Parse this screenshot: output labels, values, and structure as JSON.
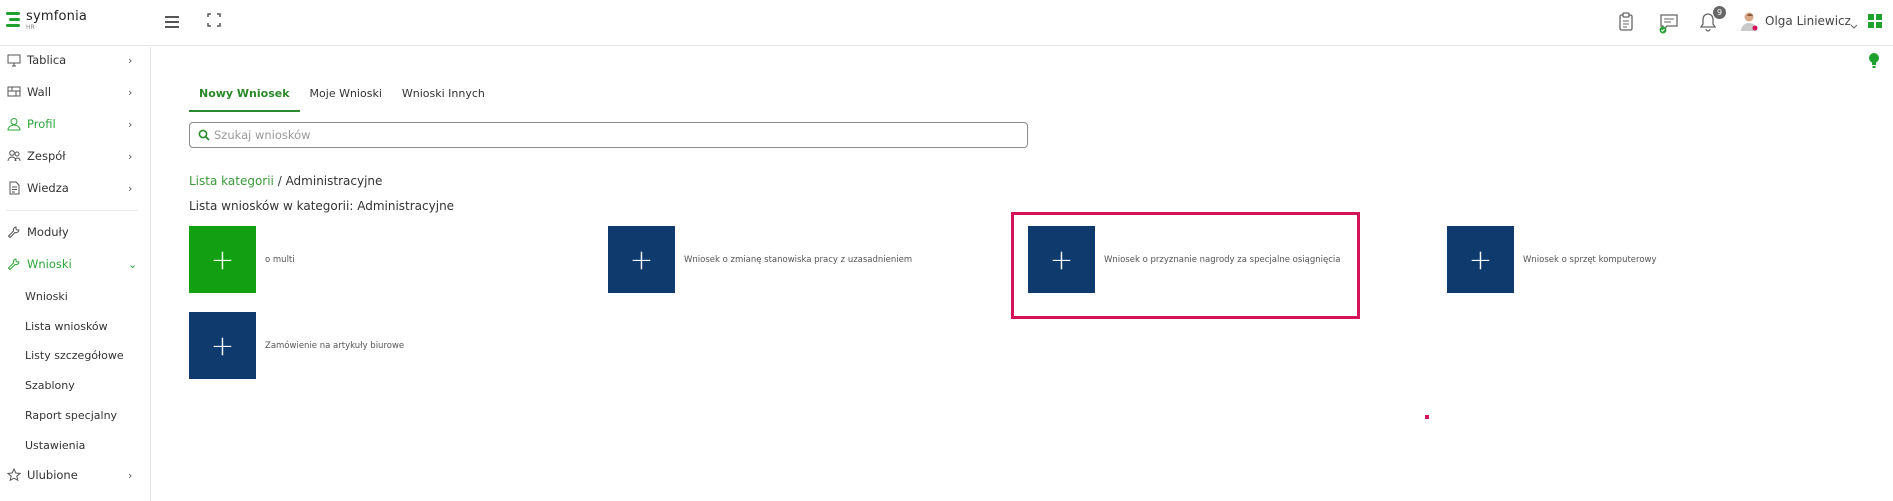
{
  "app": {
    "logo_name": "symfonia",
    "logo_sub": "HR",
    "brand_color": "#1fa12f",
    "accent_color": "#2a8a2a",
    "highlight_color": "#d4145a"
  },
  "header": {
    "menu_icon": "hamburger-icon",
    "fullscreen_icon": "fullscreen-icon",
    "clipboard_icon": "clipboard-icon",
    "messages_icon": "chat-icon",
    "notifications_icon": "bell-icon",
    "notifications_count": "9",
    "user_name": "Olga Liniewicz",
    "user_menu_icon": "chevron-down-icon",
    "apps_icon": "apps-grid-icon"
  },
  "sidebar": {
    "items": [
      {
        "label": "Tablica",
        "icon": "monitor-icon"
      },
      {
        "label": "Wall",
        "icon": "wall-icon"
      },
      {
        "label": "Profil",
        "icon": "user-icon"
      },
      {
        "label": "Zespół",
        "icon": "team-icon"
      },
      {
        "label": "Wiedza",
        "icon": "document-icon"
      },
      {
        "label": "Moduły",
        "icon": "wrench-icon"
      },
      {
        "label": "Wnioski",
        "icon": "wrench-icon"
      },
      {
        "label": "Ulubione",
        "icon": "star-icon"
      }
    ],
    "subitems": [
      "Wnioski",
      "Lista wniosków",
      "Listy szczegółowe",
      "Szablony",
      "Raport specjalny",
      "Ustawienia"
    ]
  },
  "main": {
    "tabs": [
      "Nowy Wniosek",
      "Moje Wnioski",
      "Wnioski Innych"
    ],
    "search_placeholder": "Szukaj wniosków",
    "breadcrumb_link": "Lista kategorii",
    "breadcrumb_sep": " / ",
    "breadcrumb_current": "Administracyjne",
    "category_title": "Lista wniosków w kategorii: Administracyjne",
    "cards": [
      {
        "label": "o multi",
        "color": "#12a012"
      },
      {
        "label": "Wniosek o zmianę stanowiska pracy z uzasadnieniem",
        "color": "#0e3a6e"
      },
      {
        "label": "Wniosek o przyznanie nagrody za specjalne osiągnięcia",
        "color": "#0e3a6e"
      },
      {
        "label": "Wniosek o sprzęt komputerowy",
        "color": "#0e3a6e"
      },
      {
        "label": "Zamówienie na artykuły biurowe",
        "color": "#0e3a6e"
      }
    ],
    "plus_symbol": "+"
  }
}
